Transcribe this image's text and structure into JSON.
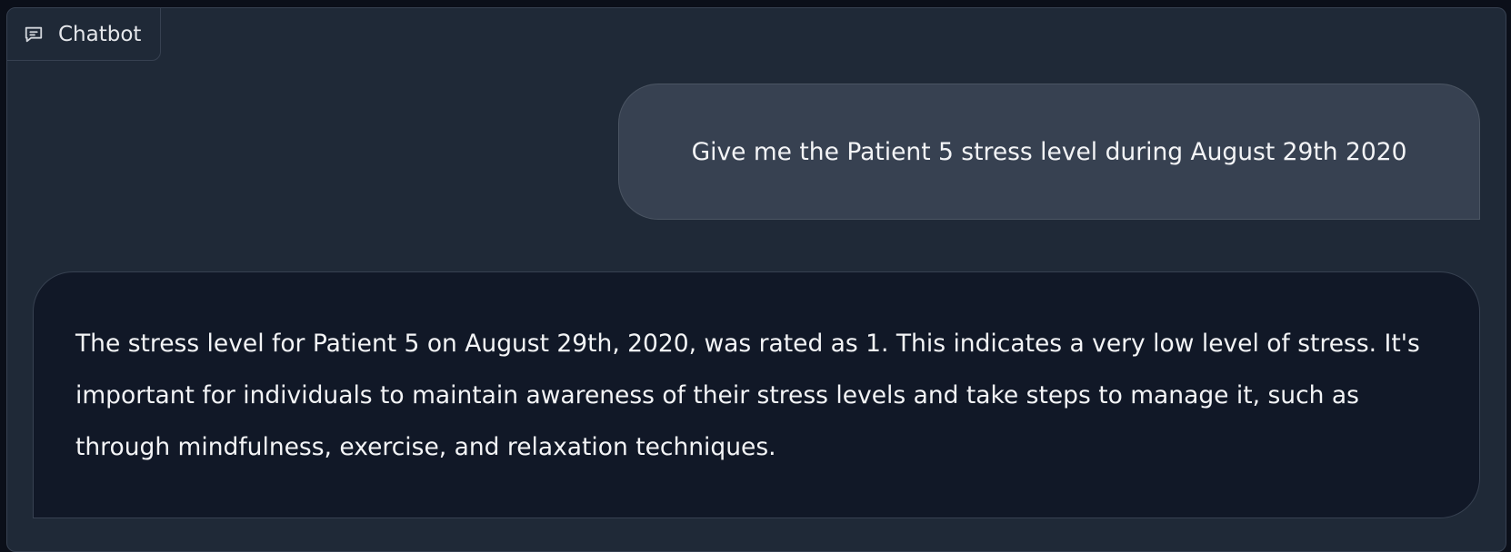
{
  "component": {
    "label": "Chatbot",
    "icon": "chat-bubble-icon"
  },
  "messages": [
    {
      "role": "user",
      "text": "Give me the Patient 5 stress level during August 29th 2020"
    },
    {
      "role": "bot",
      "text": "The stress level for Patient 5 on August 29th, 2020, was rated as 1. This indicates a very low level of stress. It's important for individuals to maintain awareness of their stress levels and take steps to manage it, such as through mindfulness, exercise, and relaxation techniques."
    }
  ],
  "colors": {
    "background": "#0b0f19",
    "panel": "#1f2937",
    "user_bubble": "#374151",
    "bot_bubble": "#111827",
    "text": "#f3f4f6"
  }
}
